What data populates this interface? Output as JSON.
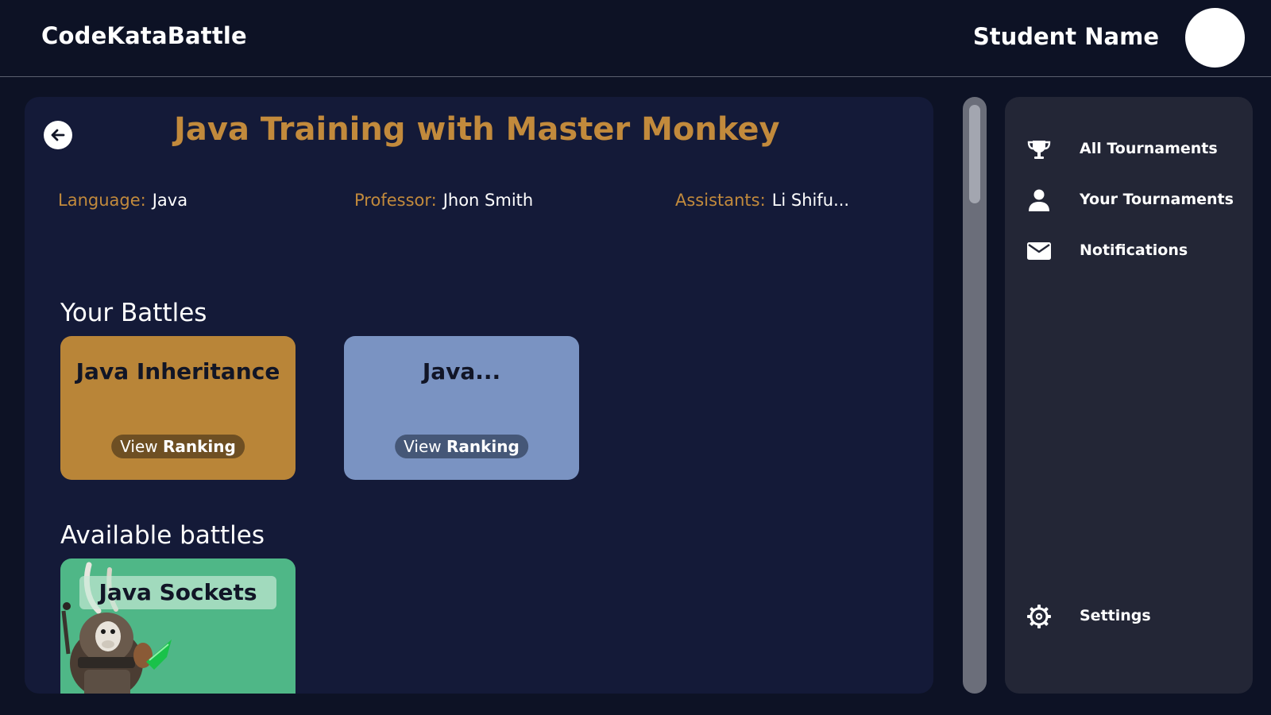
{
  "header": {
    "brand": "CodeKataBattle",
    "user_name": "Student Name"
  },
  "tournament": {
    "title": "Java Training with Master Monkey",
    "language_label": "Language:",
    "language": "Java",
    "professor_label": "Professor:",
    "professor": "Jhon Smith",
    "assistants_label": "Assistants:",
    "assistants": "Li Shifu..."
  },
  "your_battles": {
    "title": "Your Battles",
    "cards": [
      {
        "name": "Java Inheritance",
        "view_label": "View",
        "ranking_label": "Ranking",
        "color": "#b98538"
      },
      {
        "name": "Java...",
        "view_label": "View",
        "ranking_label": "Ranking",
        "color": "#7a93c2"
      }
    ]
  },
  "available_battles": {
    "title": "Available battles",
    "cards": [
      {
        "name": "Java Sockets",
        "color": "#4fb787"
      }
    ]
  },
  "sidebar": {
    "items": [
      {
        "label": "All Tournaments",
        "icon": "trophy-icon"
      },
      {
        "label": "Your Tournaments",
        "icon": "person-icon"
      },
      {
        "label": "Notifications",
        "icon": "mail-icon"
      },
      {
        "label": "Settings",
        "icon": "gear-icon"
      }
    ]
  },
  "colors": {
    "accent": "#c28a3c",
    "background": "#0d1225",
    "panel": "#141a38",
    "sidebar": "#232636"
  }
}
